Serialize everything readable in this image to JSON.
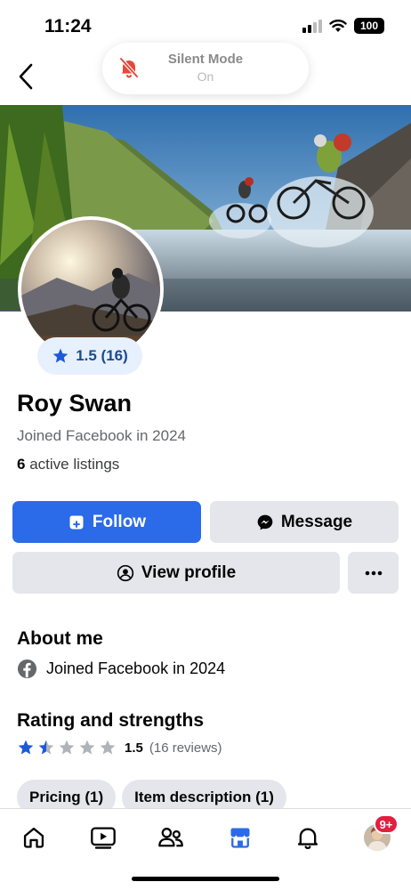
{
  "status_bar": {
    "time": "11:24",
    "battery": "100"
  },
  "silent_banner": {
    "title": "Silent Mode",
    "subtitle": "On"
  },
  "profile": {
    "rating_label": "1.5 (16)",
    "name": "Roy Swan",
    "joined": "Joined Facebook in 2024",
    "listings_count": "6",
    "listings_label": "active listings"
  },
  "actions": {
    "follow": "Follow",
    "message": "Message",
    "view_profile": "View profile",
    "more": "..."
  },
  "about": {
    "title": "About me",
    "joined": "Joined Facebook in 2024"
  },
  "rating": {
    "title": "Rating and strengths",
    "value": "1.5",
    "reviews": "(16 reviews)",
    "stars": 1.5,
    "max_stars": 5
  },
  "strengths": [
    {
      "label": "Pricing (1)"
    },
    {
      "label": "Item description (1)"
    }
  ],
  "tabbar": {
    "items": [
      "home-icon",
      "video-icon",
      "friends-icon",
      "marketplace-icon",
      "bell-icon",
      "profile-avatar"
    ],
    "badge": "9+"
  },
  "colors": {
    "accent": "#2b6ae8",
    "button_gray": "#e4e6eb",
    "badge_red": "#e41e3f",
    "rating_bg": "#e7f0fd"
  }
}
